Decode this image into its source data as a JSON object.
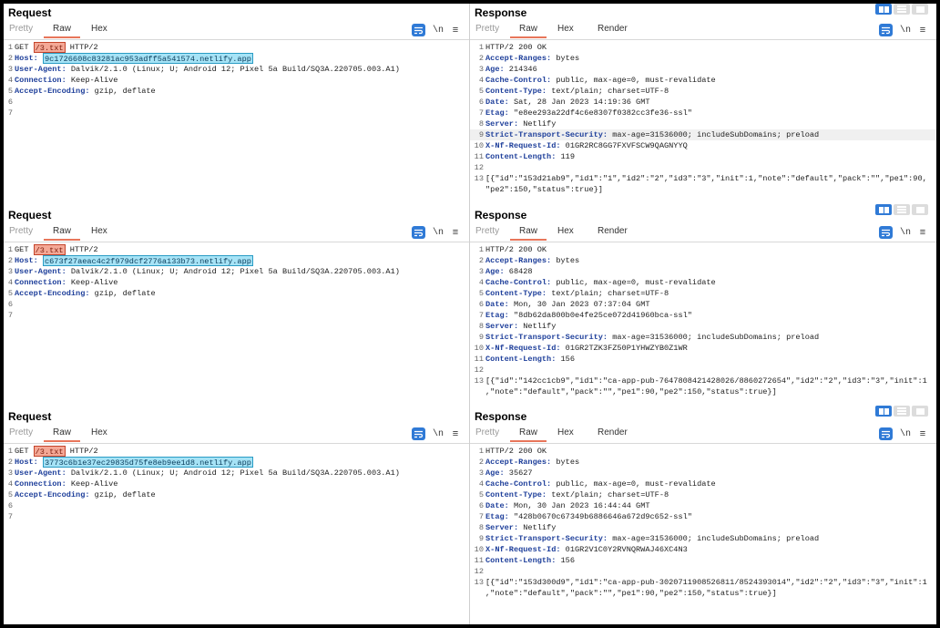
{
  "labels": {
    "request": "Request",
    "response": "Response",
    "tab_pretty": "Pretty",
    "tab_raw": "Raw",
    "tab_hex": "Hex",
    "tab_render": "Render",
    "newline_toggle": "\\n",
    "menu": "≡"
  },
  "panels": [
    {
      "request": {
        "method": "GET ",
        "path": "/3.txt",
        "protocol": " HTTP/2",
        "host_key": "Host:",
        "host_value": "9c1726608c83281ac953adff5a541574.netlify.app",
        "lines": [
          {
            "k": "User-Agent:",
            "v": " Dalvik/2.1.0 (Linux; U; Android 12; Pixel 5a Build/SQ3A.220705.003.A1)"
          },
          {
            "k": "Connection:",
            "v": " Keep-Alive"
          },
          {
            "k": "Accept-Encoding:",
            "v": " gzip, deflate"
          }
        ]
      },
      "response": {
        "lines": [
          {
            "k": "",
            "v": "HTTP/2 200 OK"
          },
          {
            "k": "Accept-Ranges:",
            "v": " bytes"
          },
          {
            "k": "Age:",
            "v": " 214346"
          },
          {
            "k": "Cache-Control:",
            "v": " public, max-age=0, must-revalidate"
          },
          {
            "k": "Content-Type:",
            "v": " text/plain; charset=UTF-8"
          },
          {
            "k": "Date:",
            "v": " Sat, 28 Jan 2023 14:19:36 GMT"
          },
          {
            "k": "Etag:",
            "v": " \"e8ee293a22df4c6e8307f0382cc3fe36-ssl\""
          },
          {
            "k": "Server:",
            "v": " Netlify"
          },
          {
            "k": "Strict-Transport-Security:",
            "v": " max-age=31536000; includeSubDomains; preload"
          },
          {
            "k": "X-Nf-Request-Id:",
            "v": " 01GR2RC8GG7FXVFSCW9QAGNYYQ"
          },
          {
            "k": "Content-Length:",
            "v": " 119"
          },
          {
            "k": "",
            "v": ""
          },
          {
            "k": "",
            "v": "[{\"id\":\"153d21ab9\",\"id1\":\"1\",\"id2\":\"2\",\"id3\":\"3\",\"init\":1,\"note\":\"default\",\"pack\":\"\",\"pe1\":90,"
          },
          {
            "k": "",
            "v": "\"pe2\":150,\"status\":true}]",
            "cont": true
          }
        ]
      }
    },
    {
      "request": {
        "method": "GET ",
        "path": "/3.txt",
        "protocol": " HTTP/2",
        "host_key": "Host:",
        "host_value": "c673f27aeac4c2f979dcf2776a133b73.netlify.app",
        "lines": [
          {
            "k": "User-Agent:",
            "v": " Dalvik/2.1.0 (Linux; U; Android 12; Pixel 5a Build/SQ3A.220705.003.A1)"
          },
          {
            "k": "Connection:",
            "v": " Keep-Alive"
          },
          {
            "k": "Accept-Encoding:",
            "v": " gzip, deflate"
          }
        ]
      },
      "response": {
        "lines": [
          {
            "k": "",
            "v": "HTTP/2 200 OK"
          },
          {
            "k": "Accept-Ranges:",
            "v": " bytes"
          },
          {
            "k": "Age:",
            "v": " 68428"
          },
          {
            "k": "Cache-Control:",
            "v": " public, max-age=0, must-revalidate"
          },
          {
            "k": "Content-Type:",
            "v": " text/plain; charset=UTF-8"
          },
          {
            "k": "Date:",
            "v": " Mon, 30 Jan 2023 07:37:04 GMT"
          },
          {
            "k": "Etag:",
            "v": " \"8db62da800b0e4fe25ce072d41960bca-ssl\""
          },
          {
            "k": "Server:",
            "v": " Netlify"
          },
          {
            "k": "Strict-Transport-Security:",
            "v": " max-age=31536000; includeSubDomains; preload"
          },
          {
            "k": "X-Nf-Request-Id:",
            "v": " 01GR2TZK3FZ50P1YHWZYB0Z1WR"
          },
          {
            "k": "Content-Length:",
            "v": " 156"
          },
          {
            "k": "",
            "v": ""
          },
          {
            "k": "",
            "v": "[{\"id\":\"142cc1cb9\",\"id1\":\"ca-app-pub-7647808421428026/8860272654\",\"id2\":\"2\",\"id3\":\"3\",\"init\":1"
          },
          {
            "k": "",
            "v": ",\"note\":\"default\",\"pack\":\"\",\"pe1\":90,\"pe2\":150,\"status\":true}]",
            "cont": true
          }
        ]
      }
    },
    {
      "request": {
        "method": "GET ",
        "path": "/3.txt",
        "protocol": " HTTP/2",
        "host_key": "Host:",
        "host_value": "3773c6b1e37ec29835d75fe8eb9ee1d8.netlify.app",
        "lines": [
          {
            "k": "User-Agent:",
            "v": " Dalvik/2.1.0 (Linux; U; Android 12; Pixel 5a Build/SQ3A.220705.003.A1)"
          },
          {
            "k": "Connection:",
            "v": " Keep-Alive"
          },
          {
            "k": "Accept-Encoding:",
            "v": " gzip, deflate"
          }
        ]
      },
      "response": {
        "lines": [
          {
            "k": "",
            "v": "HTTP/2 200 OK"
          },
          {
            "k": "Accept-Ranges:",
            "v": " bytes"
          },
          {
            "k": "Age:",
            "v": " 35627"
          },
          {
            "k": "Cache-Control:",
            "v": " public, max-age=0, must-revalidate"
          },
          {
            "k": "Content-Type:",
            "v": " text/plain; charset=UTF-8"
          },
          {
            "k": "Date:",
            "v": " Mon, 30 Jan 2023 16:44:44 GMT"
          },
          {
            "k": "Etag:",
            "v": " \"428b0670c67349b6886646a672d9c652-ssl\""
          },
          {
            "k": "Server:",
            "v": " Netlify"
          },
          {
            "k": "Strict-Transport-Security:",
            "v": " max-age=31536000; includeSubDomains; preload"
          },
          {
            "k": "X-Nf-Request-Id:",
            "v": " 01GR2V1C0Y2RVNQRWAJ46XC4N3"
          },
          {
            "k": "Content-Length:",
            "v": " 156"
          },
          {
            "k": "",
            "v": ""
          },
          {
            "k": "",
            "v": "[{\"id\":\"153d300d9\",\"id1\":\"ca-app-pub-3020711908526811/8524393014\",\"id2\":\"2\",\"id3\":\"3\",\"init\":1"
          },
          {
            "k": "",
            "v": ",\"note\":\"default\",\"pack\":\"\",\"pe1\":90,\"pe2\":150,\"status\":true}]",
            "cont": true
          }
        ]
      }
    }
  ]
}
